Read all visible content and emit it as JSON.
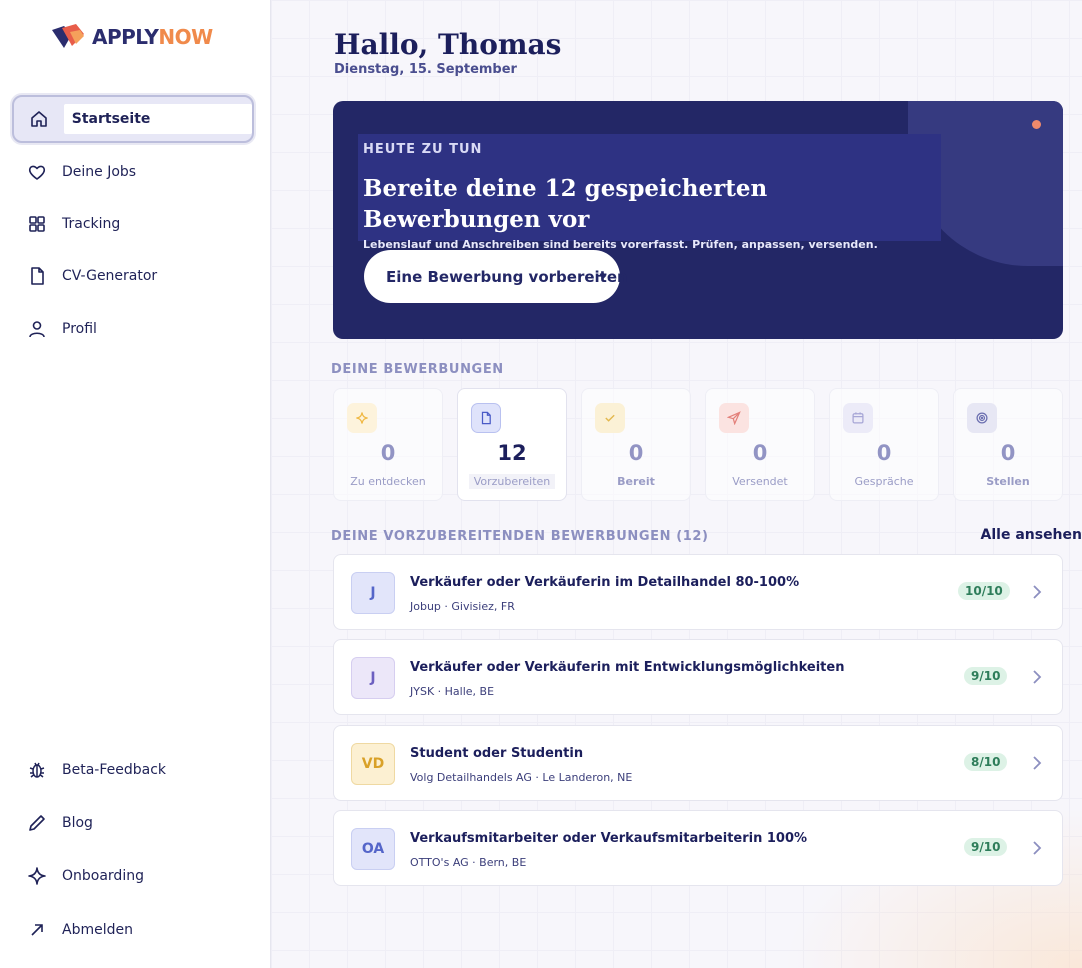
{
  "brand": {
    "name_a": "APPLY",
    "name_b": "NOW"
  },
  "sidebar": {
    "items": [
      {
        "label": "Startseite",
        "icon": "home-icon"
      },
      {
        "label": "Deine Jobs",
        "icon": "heart-icon"
      },
      {
        "label": "Tracking",
        "icon": "grid-icon"
      },
      {
        "label": "CV-Generator",
        "icon": "document-icon"
      },
      {
        "label": "Profil",
        "icon": "user-icon"
      }
    ],
    "bottom": [
      {
        "label": "Beta-Feedback",
        "icon": "bug-icon"
      },
      {
        "label": "Blog",
        "icon": "pencil-icon"
      },
      {
        "label": "Onboarding",
        "icon": "sparkle-icon"
      },
      {
        "label": "Abmelden",
        "icon": "logout-icon"
      }
    ]
  },
  "header": {
    "greeting": "Hallo, Thomas",
    "date": "Dienstag, 15. September"
  },
  "hero": {
    "eyebrow": "HEUTE ZU TUN",
    "title": "Bereite deine 12 gespeicherten Bewerbungen vor",
    "subtitle": "Lebenslauf und Anschreiben sind bereits vorerfasst. Prüfen, anpassen, versenden.",
    "button": "Eine Bewerbung vorbereiten",
    "button_arrow": "→"
  },
  "applications": {
    "label": "DEINE BEWERBUNGEN",
    "stats": [
      {
        "value": "0",
        "label": "Zu entdecken",
        "icon": "sparkle-icon",
        "color": "#f6c667",
        "bg": "#fdf3dc"
      },
      {
        "value": "12",
        "label": "Vorzubereiten",
        "icon": "document-icon",
        "color": "#4a5bc7",
        "bg": "#dfe3fb"
      },
      {
        "value": "0",
        "label": "Bereit",
        "icon": "check-icon",
        "color": "#e3b84e",
        "bg": "#fbf1d6"
      },
      {
        "value": "0",
        "label": "Versendet",
        "icon": "send-icon",
        "color": "#e3807a",
        "bg": "#fbe3e1"
      },
      {
        "value": "0",
        "label": "Gespräche",
        "icon": "calendar-icon",
        "color": "#a7a6d6",
        "bg": "#ecebf8"
      },
      {
        "value": "0",
        "label": "Stellen",
        "icon": "target-icon",
        "color": "#6b6fb0",
        "bg": "#e7e7f4"
      }
    ]
  },
  "pending": {
    "label": "DEINE VORZUBEREITENDEN BEWERBUNGEN (12)",
    "see_all": "Alle ansehen",
    "rows": [
      {
        "initials": "J",
        "title": "Verkäufer oder Verkäuferin im Detailhandel 80-100%",
        "sub": "Jobup · Givisiez, FR",
        "score": "10/10",
        "badge_bg": "#e2e5fa",
        "badge_fg": "#5566c9",
        "badge_border": "#c9cff2"
      },
      {
        "initials": "J",
        "title": "Verkäufer oder Verkäuferin mit Entwicklungsmöglichkeiten",
        "sub": "JYSK · Halle, BE",
        "score": "9/10",
        "badge_bg": "#ece7f9",
        "badge_fg": "#6c5fc0",
        "badge_border": "#d6cef0"
      },
      {
        "initials": "VD",
        "title": "Student oder Studentin",
        "sub": "Volg Detailhandels AG · Le Landeron, NE",
        "score": "8/10",
        "badge_bg": "#fcf0d2",
        "badge_fg": "#d9a128",
        "badge_border": "#efd9a2"
      },
      {
        "initials": "OA",
        "title": "Verkaufsmitarbeiter oder Verkaufsmitarbeiterin 100%",
        "sub": "OTTO's AG · Bern, BE",
        "score": "9/10",
        "badge_bg": "#e2e5fa",
        "badge_fg": "#5566c9",
        "badge_border": "#c9cff2"
      }
    ]
  }
}
